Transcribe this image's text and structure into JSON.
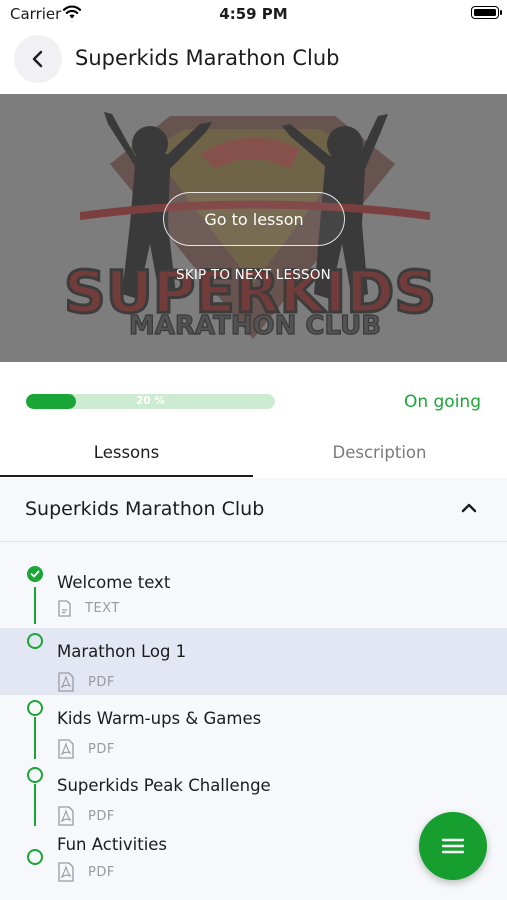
{
  "status_bar": {
    "carrier": "Carrier",
    "time": "4:59 PM"
  },
  "header": {
    "title": "Superkids Marathon Club",
    "back_icon": "chevron-left-icon"
  },
  "banner": {
    "logo_text_line1": "SUPERKIDS",
    "logo_text_line2": "MARATHON CLUB",
    "go_to_lesson_label": "Go to lesson",
    "skip_label": "SKIP TO NEXT LESSON"
  },
  "progress": {
    "value_percent": 20,
    "label": "20 %",
    "status": "On going",
    "color": "#1aa636"
  },
  "tabs": [
    {
      "label": "Lessons",
      "active": true
    },
    {
      "label": "Description",
      "active": false
    }
  ],
  "section": {
    "title": "Superkids Marathon Club",
    "expanded": true
  },
  "lessons": [
    {
      "title": "Welcome text",
      "type": "TEXT",
      "icon": "text-file-icon",
      "completed": true,
      "current": false
    },
    {
      "title": "Marathon Log 1",
      "type": "PDF",
      "icon": "pdf-file-icon",
      "completed": false,
      "current": true
    },
    {
      "title": "Kids Warm-ups & Games",
      "type": "PDF",
      "icon": "pdf-file-icon",
      "completed": false,
      "current": false
    },
    {
      "title": "Superkids Peak Challenge",
      "type": "PDF",
      "icon": "pdf-file-icon",
      "completed": false,
      "current": false
    },
    {
      "title": "Fun Activities",
      "type": "PDF",
      "icon": "pdf-file-icon",
      "completed": false,
      "current": false
    }
  ],
  "fab": {
    "icon": "menu-icon"
  }
}
